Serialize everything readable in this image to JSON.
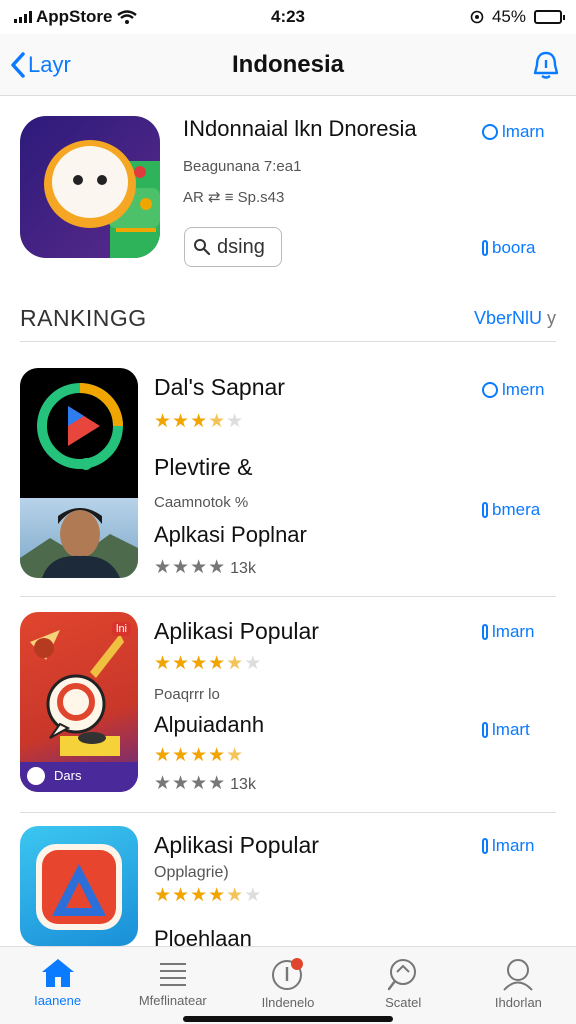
{
  "status": {
    "carrier": "AppStore",
    "time": "4:23",
    "battery": "45%",
    "battery_level": 0.45
  },
  "nav": {
    "back_label": "Layr",
    "title": "Indonesia"
  },
  "featured": {
    "title": "INdonnaial lkn Dnoresia",
    "subtitle": "Beagunana 7:ea1",
    "price": "AR ⇄ ≡ Sp.s43",
    "search_label": "dsing",
    "action_top": "lmarn",
    "action_bottom": "boora"
  },
  "section": {
    "title": "RANKINGG",
    "more": "VberNlU"
  },
  "rows": [
    {
      "name": "Dal's Sapnar",
      "rating": 3.5,
      "subtitle": "Plevtire &",
      "small": "Caamnotok %",
      "name2": "Aplkasi Poplnar",
      "count": "13k",
      "action_top": "lmern",
      "action_bottom": "bmera"
    },
    {
      "name": "Aplikasi Popular",
      "rating": 4.5,
      "small": "Poaqrrr lo",
      "name2": "Alpuiadanh",
      "rating2": 4.5,
      "count": "13k",
      "icon_badge": "Dars",
      "icon_tag": "lni",
      "action_top": "lmarn",
      "action_bottom": "lmart"
    },
    {
      "name": "Aplikasi Popular",
      "small": "Opplagrie)",
      "rating": 4.5,
      "name2": "Ploehlaan",
      "action_top": "lmarn"
    }
  ],
  "tabs": [
    {
      "label": "Iaanene",
      "icon": "home-icon",
      "active": true
    },
    {
      "label": "Mfeflinatear",
      "icon": "list-icon",
      "active": false
    },
    {
      "label": "Ilndenelo",
      "icon": "updates-icon",
      "active": false
    },
    {
      "label": "Scatel",
      "icon": "search-icon",
      "active": false
    },
    {
      "label": "Ihdorlan",
      "icon": "person-icon",
      "active": false
    }
  ],
  "colors": {
    "accent": "#0a7aff",
    "star": "#f0a500"
  }
}
